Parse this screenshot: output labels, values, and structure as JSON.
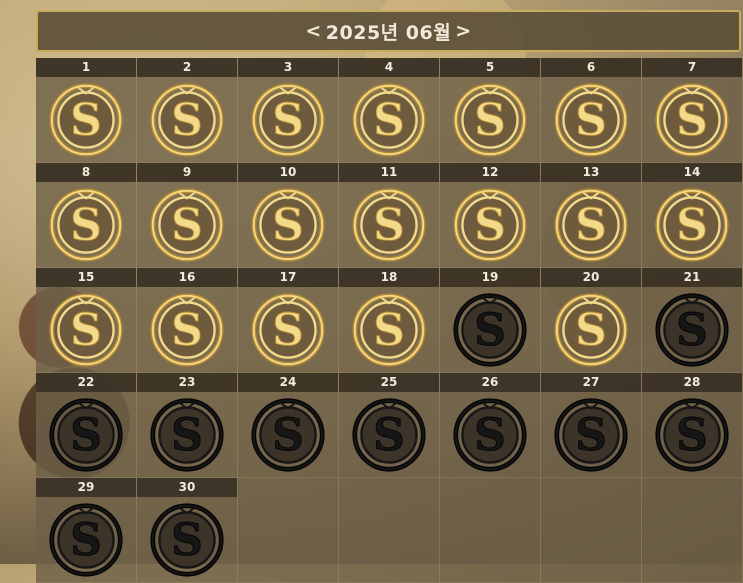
{
  "header": {
    "prev": "<",
    "title": "2025년 06월",
    "next": ">"
  },
  "colors": {
    "checked_coin": "#d9b65a",
    "unchecked_coin": "#111111",
    "cell_bg": "#6e6048",
    "day_label_bg": "#373024"
  },
  "days": [
    {
      "day": "1",
      "checked": true
    },
    {
      "day": "2",
      "checked": true
    },
    {
      "day": "3",
      "checked": true
    },
    {
      "day": "4",
      "checked": true
    },
    {
      "day": "5",
      "checked": true
    },
    {
      "day": "6",
      "checked": true
    },
    {
      "day": "7",
      "checked": true
    },
    {
      "day": "8",
      "checked": true
    },
    {
      "day": "9",
      "checked": true
    },
    {
      "day": "10",
      "checked": true
    },
    {
      "day": "11",
      "checked": true
    },
    {
      "day": "12",
      "checked": true
    },
    {
      "day": "13",
      "checked": true
    },
    {
      "day": "14",
      "checked": true
    },
    {
      "day": "15",
      "checked": true
    },
    {
      "day": "16",
      "checked": true
    },
    {
      "day": "17",
      "checked": true
    },
    {
      "day": "18",
      "checked": true
    },
    {
      "day": "19",
      "checked": false
    },
    {
      "day": "20",
      "checked": true
    },
    {
      "day": "21",
      "checked": false
    },
    {
      "day": "22",
      "checked": false
    },
    {
      "day": "23",
      "checked": false
    },
    {
      "day": "24",
      "checked": false
    },
    {
      "day": "25",
      "checked": false
    },
    {
      "day": "26",
      "checked": false
    },
    {
      "day": "27",
      "checked": false
    },
    {
      "day": "28",
      "checked": false
    },
    {
      "day": "29",
      "checked": false
    },
    {
      "day": "30",
      "checked": false
    }
  ],
  "empty_cells": 5,
  "coin_icon": "s-coin-icon"
}
